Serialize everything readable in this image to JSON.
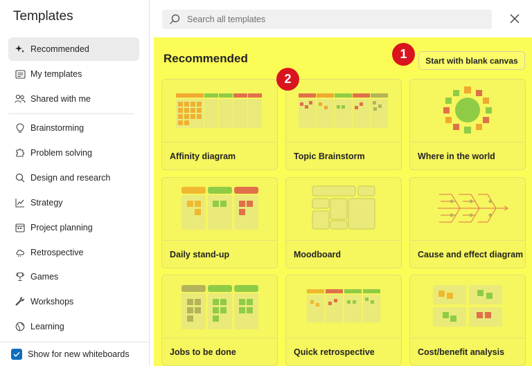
{
  "sidebar": {
    "title": "Templates",
    "items": [
      {
        "label": "Recommended",
        "icon": "sparkle-icon",
        "active": true
      },
      {
        "label": "My templates",
        "icon": "template-icon"
      },
      {
        "label": "Shared with me",
        "icon": "people-icon"
      },
      {
        "label": "Brainstorming",
        "icon": "lightbulb-icon"
      },
      {
        "label": "Problem solving",
        "icon": "puzzle-icon"
      },
      {
        "label": "Design and research",
        "icon": "search-icon"
      },
      {
        "label": "Strategy",
        "icon": "chart-line-icon"
      },
      {
        "label": "Project planning",
        "icon": "calendar-icon"
      },
      {
        "label": "Retrospective",
        "icon": "cloud-icon"
      },
      {
        "label": "Games",
        "icon": "trophy-icon"
      },
      {
        "label": "Workshops",
        "icon": "wrench-icon"
      },
      {
        "label": "Learning",
        "icon": "globe-icon"
      }
    ],
    "footer_label": "Show for new whiteboards",
    "footer_checked": true
  },
  "search": {
    "placeholder": "Search all templates"
  },
  "main": {
    "title": "Recommended",
    "blank_button": "Start with blank canvas",
    "badges": [
      "1",
      "2"
    ],
    "cards": [
      {
        "label": "Affinity diagram"
      },
      {
        "label": "Topic Brainstorm"
      },
      {
        "label": "Where in the world"
      },
      {
        "label": "Daily stand-up"
      },
      {
        "label": "Moodboard"
      },
      {
        "label": "Cause and effect diagram"
      },
      {
        "label": "Jobs to be done"
      },
      {
        "label": "Quick retrospective"
      },
      {
        "label": "Cost/benefit analysis"
      }
    ]
  },
  "colors": {
    "highlight": "#fcfc56",
    "badge": "#d9141e",
    "checkbox": "#0f6cbd",
    "orange": "#f0a830",
    "green": "#8fcc46",
    "red": "#e0704a",
    "olive": "#b4b45a"
  }
}
